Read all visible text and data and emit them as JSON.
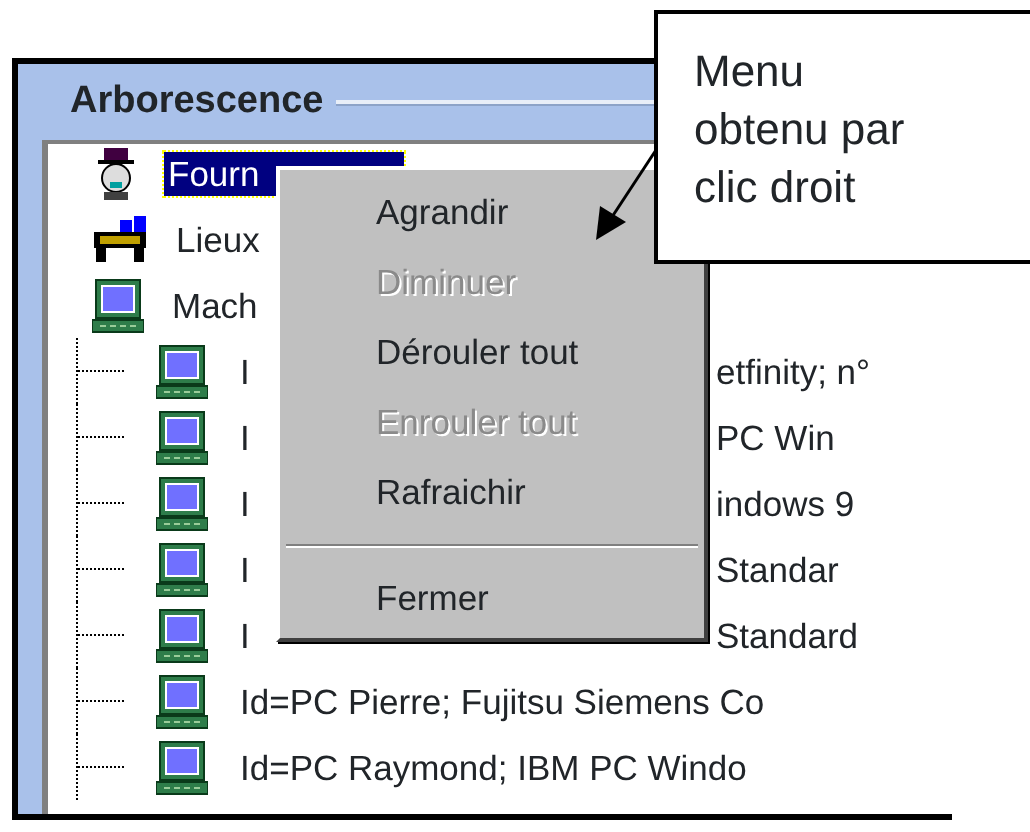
{
  "panel": {
    "title": "Arborescence"
  },
  "tree": [
    {
      "kind": "supplier",
      "label": "Fourn",
      "selected": true
    },
    {
      "kind": "places",
      "label": "Lieux",
      "selected": false
    },
    {
      "kind": "machines",
      "label": "Mach",
      "selected": false,
      "expanded": true,
      "children": [
        {
          "kind": "machine",
          "label": "I",
          "tail": "etfinity; n°",
          "selected": false
        },
        {
          "kind": "machine",
          "label": "I",
          "tail": "PC Win",
          "selected": false
        },
        {
          "kind": "machine",
          "label": "I",
          "tail": "indows 9",
          "selected": false
        },
        {
          "kind": "machine",
          "label": "I",
          "tail": "Standar",
          "selected": false
        },
        {
          "kind": "machine",
          "label": "I",
          "tail": "Standard",
          "selected": false
        },
        {
          "kind": "machine",
          "label": "Id=PC Pierre; Fujitsu Siemens Co",
          "selected": false
        },
        {
          "kind": "machine",
          "label": "Id=PC Raymond; IBM PC Windo",
          "selected": false
        }
      ]
    }
  ],
  "context_menu": {
    "items": [
      {
        "kind": "command",
        "label": "Agrandir",
        "disabled": false
      },
      {
        "kind": "command",
        "label": "Diminuer",
        "disabled": true
      },
      {
        "kind": "command",
        "label": "Dérouler tout",
        "disabled": false
      },
      {
        "kind": "command",
        "label": "Enrouler tout",
        "disabled": true
      },
      {
        "kind": "command",
        "label": "Rafraichir",
        "disabled": false
      },
      {
        "kind": "separator"
      },
      {
        "kind": "command",
        "label": "Fermer",
        "disabled": false
      }
    ]
  },
  "callout": {
    "text": "Menu obtenu par clic droit"
  }
}
